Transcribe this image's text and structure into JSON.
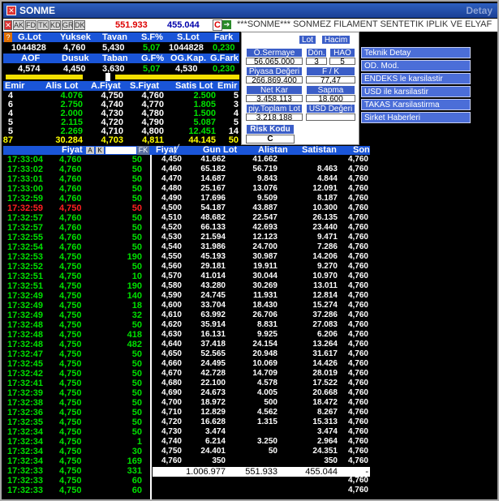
{
  "window": {
    "title": "SONME",
    "right_title": "Detay"
  },
  "toolbar": {
    "buttons": [
      "AK",
      "FD",
      "TK",
      "KD",
      "GR",
      "DK"
    ],
    "value1": "551.933",
    "value2": "455.044",
    "c_label": "C",
    "ticker": "***SONME*** SONMEZ FILAMENT SENTETIK IPLIK VE ELYAF"
  },
  "summary": {
    "row1_headers": [
      "G.Lot",
      "Yuksek",
      "Tavan",
      "S.F%",
      "S.Lot",
      "Fark"
    ],
    "row1_values": [
      "1044828",
      "4,760",
      "5,430",
      "5,07",
      "1044828",
      "0,230"
    ],
    "row2_headers": [
      "AOF",
      "Dusuk",
      "Taban",
      "G.F%",
      "OG.Kap.",
      "G.Fark"
    ],
    "row2_values": [
      "4,574",
      "4,450",
      "3,630",
      "5,07",
      "4,530",
      "0,230"
    ]
  },
  "depth": {
    "headers": [
      "Emir",
      "Alis Lot",
      "A.Fiyat",
      "S.Fiyat",
      "Satis Lot",
      "Emir"
    ],
    "rows": [
      [
        "4",
        "4.076",
        "4,750",
        "4,760",
        "2.500",
        "5"
      ],
      [
        "6",
        "2.750",
        "4,740",
        "4,770",
        "1.805",
        "3"
      ],
      [
        "4",
        "2.000",
        "4,730",
        "4,780",
        "1.500",
        "4"
      ],
      [
        "5",
        "2.115",
        "4,720",
        "4,790",
        "5.087",
        "5"
      ],
      [
        "5",
        "2.269",
        "4,710",
        "4,800",
        "12.451",
        "14"
      ]
    ],
    "totals": [
      "87",
      "30.284",
      "4,703",
      "4,811",
      "44.145",
      "50"
    ]
  },
  "panel": {
    "lot_btn": "Lot",
    "hacim_btn": "Hacim",
    "osermaye_label": "Ö.Sermaye",
    "osermaye_value": "56.065.000",
    "don_label": "Dön.",
    "don_value": "3",
    "hao_label": "HAO",
    "hao_value": "5",
    "piyasa_label": "Piyasa Değeri",
    "piyasa_value": "266.869.400",
    "fk_label": "F / K",
    "fk_value": "77,47",
    "netkar_label": "Net Kar",
    "netkar_value": "3.458.113",
    "sapma_label": "Sapma",
    "sapma_value": "18.600",
    "piytoplam_label": "piy.Toplam Lot",
    "piytoplam_value": "3.218.188",
    "usd_label": "USD Değeri",
    "risk_label": "Risk Kodu",
    "risk_value": "C"
  },
  "menu": [
    "Teknik Detay",
    "OD. Mod.",
    "ENDEKS le karsilastir",
    "USD ile karsilastir",
    "TAKAS Karsilastirma",
    "Sirket Haberleri"
  ],
  "trades": {
    "header_label": "Fiyat",
    "header_buttons": [
      "A",
      "K"
    ],
    "fk_label": "FK",
    "rows": [
      {
        "time": "17:33:04",
        "price": "4,760",
        "lot": "50",
        "color": "green"
      },
      {
        "time": "17:33:02",
        "price": "4,760",
        "lot": "50",
        "color": "green"
      },
      {
        "time": "17:33:01",
        "price": "4,760",
        "lot": "50",
        "color": "green"
      },
      {
        "time": "17:33:00",
        "price": "4,760",
        "lot": "50",
        "color": "green"
      },
      {
        "time": "17:32:59",
        "price": "4,760",
        "lot": "50",
        "color": "green"
      },
      {
        "time": "17:32:59",
        "price": "4,750",
        "lot": "50",
        "color": "red"
      },
      {
        "time": "17:32:57",
        "price": "4,760",
        "lot": "50",
        "color": "green"
      },
      {
        "time": "17:32:57",
        "price": "4,760",
        "lot": "50",
        "color": "green"
      },
      {
        "time": "17:32:55",
        "price": "4,760",
        "lot": "50",
        "color": "green"
      },
      {
        "time": "17:32:54",
        "price": "4,760",
        "lot": "50",
        "color": "green"
      },
      {
        "time": "17:32:53",
        "price": "4,750",
        "lot": "190",
        "color": "green"
      },
      {
        "time": "17:32:52",
        "price": "4,750",
        "lot": "50",
        "color": "green"
      },
      {
        "time": "17:32:51",
        "price": "4,750",
        "lot": "10",
        "color": "green"
      },
      {
        "time": "17:32:51",
        "price": "4,750",
        "lot": "190",
        "color": "green"
      },
      {
        "time": "17:32:49",
        "price": "4,750",
        "lot": "140",
        "color": "green"
      },
      {
        "time": "17:32:49",
        "price": "4,750",
        "lot": "18",
        "color": "green"
      },
      {
        "time": "17:32:49",
        "price": "4,750",
        "lot": "32",
        "color": "green"
      },
      {
        "time": "17:32:48",
        "price": "4,750",
        "lot": "50",
        "color": "green"
      },
      {
        "time": "17:32:48",
        "price": "4,750",
        "lot": "418",
        "color": "green"
      },
      {
        "time": "17:32:48",
        "price": "4,750",
        "lot": "482",
        "color": "green"
      },
      {
        "time": "17:32:47",
        "price": "4,750",
        "lot": "50",
        "color": "green"
      },
      {
        "time": "17:32:45",
        "price": "4,750",
        "lot": "50",
        "color": "green"
      },
      {
        "time": "17:32:42",
        "price": "4,750",
        "lot": "50",
        "color": "green"
      },
      {
        "time": "17:32:41",
        "price": "4,750",
        "lot": "50",
        "color": "green"
      },
      {
        "time": "17:32:39",
        "price": "4,750",
        "lot": "50",
        "color": "green"
      },
      {
        "time": "17:32:38",
        "price": "4,750",
        "lot": "50",
        "color": "green"
      },
      {
        "time": "17:32:36",
        "price": "4,750",
        "lot": "50",
        "color": "green"
      },
      {
        "time": "17:32:35",
        "price": "4,750",
        "lot": "50",
        "color": "green"
      },
      {
        "time": "17:32:34",
        "price": "4,750",
        "lot": "50",
        "color": "green"
      },
      {
        "time": "17:32:34",
        "price": "4,750",
        "lot": "1",
        "color": "green"
      },
      {
        "time": "17:32:34",
        "price": "4,750",
        "lot": "30",
        "color": "green"
      },
      {
        "time": "17:32:34",
        "price": "4,750",
        "lot": "169",
        "color": "green"
      },
      {
        "time": "17:32:33",
        "price": "4,750",
        "lot": "331",
        "color": "green"
      },
      {
        "time": "17:32:33",
        "price": "4,750",
        "lot": "60",
        "color": "green"
      },
      {
        "time": "17:32:33",
        "price": "4,750",
        "lot": "60",
        "color": "green"
      }
    ]
  },
  "volume": {
    "headers": [
      "Fiyat",
      "Gun Lot",
      "Alistan",
      "Satistan",
      "Son"
    ],
    "rows": [
      [
        "4,450",
        "41.662",
        "41.662",
        "",
        "4,760"
      ],
      [
        "4,460",
        "65.182",
        "56.719",
        "8.463",
        "4,760"
      ],
      [
        "4,470",
        "14.687",
        "9.843",
        "4.844",
        "4,760"
      ],
      [
        "4,480",
        "25.167",
        "13.076",
        "12.091",
        "4,760"
      ],
      [
        "4,490",
        "17.696",
        "9.509",
        "8.187",
        "4,760"
      ],
      [
        "4,500",
        "54.187",
        "43.887",
        "10.300",
        "4,760"
      ],
      [
        "4,510",
        "48.682",
        "22.547",
        "26.135",
        "4,760"
      ],
      [
        "4,520",
        "66.133",
        "42.693",
        "23.440",
        "4,760"
      ],
      [
        "4,530",
        "21.594",
        "12.123",
        "9.471",
        "4,760"
      ],
      [
        "4,540",
        "31.986",
        "24.700",
        "7.286",
        "4,760"
      ],
      [
        "4,550",
        "45.193",
        "30.987",
        "14.206",
        "4,760"
      ],
      [
        "4,560",
        "29.181",
        "19.911",
        "9.270",
        "4,760"
      ],
      [
        "4,570",
        "41.014",
        "30.044",
        "10.970",
        "4,760"
      ],
      [
        "4,580",
        "43.280",
        "30.269",
        "13.011",
        "4,760"
      ],
      [
        "4,590",
        "24.745",
        "11.931",
        "12.814",
        "4,760"
      ],
      [
        "4,600",
        "33.704",
        "18.430",
        "15.274",
        "4,760"
      ],
      [
        "4,610",
        "63.992",
        "26.706",
        "37.286",
        "4,760"
      ],
      [
        "4,620",
        "35.914",
        "8.831",
        "27.083",
        "4,760"
      ],
      [
        "4,630",
        "16.131",
        "9.925",
        "6.206",
        "4,760"
      ],
      [
        "4,640",
        "37.418",
        "24.154",
        "13.264",
        "4,760"
      ],
      [
        "4,650",
        "52.565",
        "20.948",
        "31.617",
        "4,760"
      ],
      [
        "4,660",
        "24.495",
        "10.069",
        "14.426",
        "4,760"
      ],
      [
        "4,670",
        "42.728",
        "14.709",
        "28.019",
        "4,760"
      ],
      [
        "4,680",
        "22.100",
        "4.578",
        "17.522",
        "4,760"
      ],
      [
        "4,690",
        "24.673",
        "4.005",
        "20.668",
        "4,760"
      ],
      [
        "4,700",
        "18.972",
        "500",
        "18.472",
        "4,760"
      ],
      [
        "4,710",
        "12.829",
        "4.562",
        "8.267",
        "4,760"
      ],
      [
        "4,720",
        "16.628",
        "1.315",
        "15.313",
        "4,760"
      ],
      [
        "4,730",
        "3.474",
        "",
        "3.474",
        "4,760"
      ],
      [
        "4,740",
        "6.214",
        "3.250",
        "2.964",
        "4,760"
      ],
      [
        "4,750",
        "24.401",
        "50",
        "24.351",
        "4,760"
      ],
      [
        "4,760",
        "350",
        "",
        "350",
        "4,760"
      ]
    ],
    "extra_son": [
      "4,760",
      "4,760",
      "4,760"
    ],
    "totals": [
      "",
      "1.006.977",
      "551.933",
      "455.044",
      "-"
    ]
  }
}
